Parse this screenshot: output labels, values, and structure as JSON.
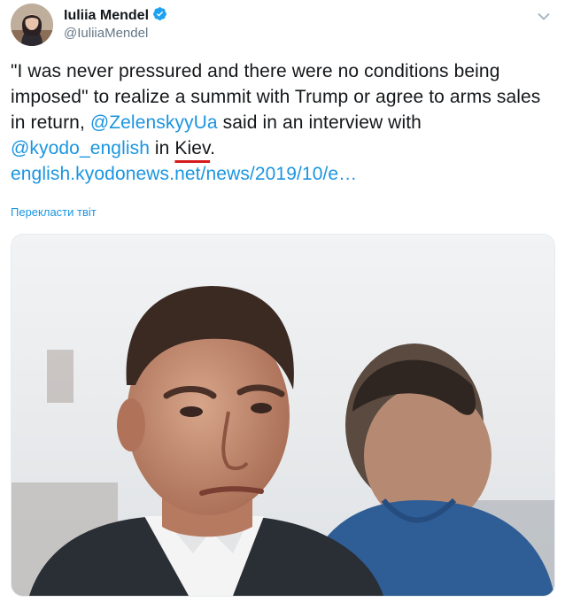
{
  "author": {
    "name": "Iuliia Mendel",
    "handle": "@IuliiaMendel",
    "verified": true
  },
  "tweet": {
    "text_part1": "\"I was never pressured and there were no conditions being imposed\" to realize a summit with Trump or agree to arms sales in return, ",
    "mention1": "@ZelenskyyUa",
    "text_part2": " said in an interview with ",
    "mention2": "@kyodo_english",
    "text_part3": " in ",
    "underlined_word": "Kiev",
    "text_part4": ".",
    "link": "english.kyodonews.net/news/2019/10/e…"
  },
  "translate_label": "Перекласти твіт",
  "icons": {
    "verified": "verified-badge-icon",
    "caret": "chevron-down-icon"
  },
  "colors": {
    "link": "#1b95e0",
    "secondary_text": "#657786",
    "underline_annotation": "#d71a1a"
  }
}
